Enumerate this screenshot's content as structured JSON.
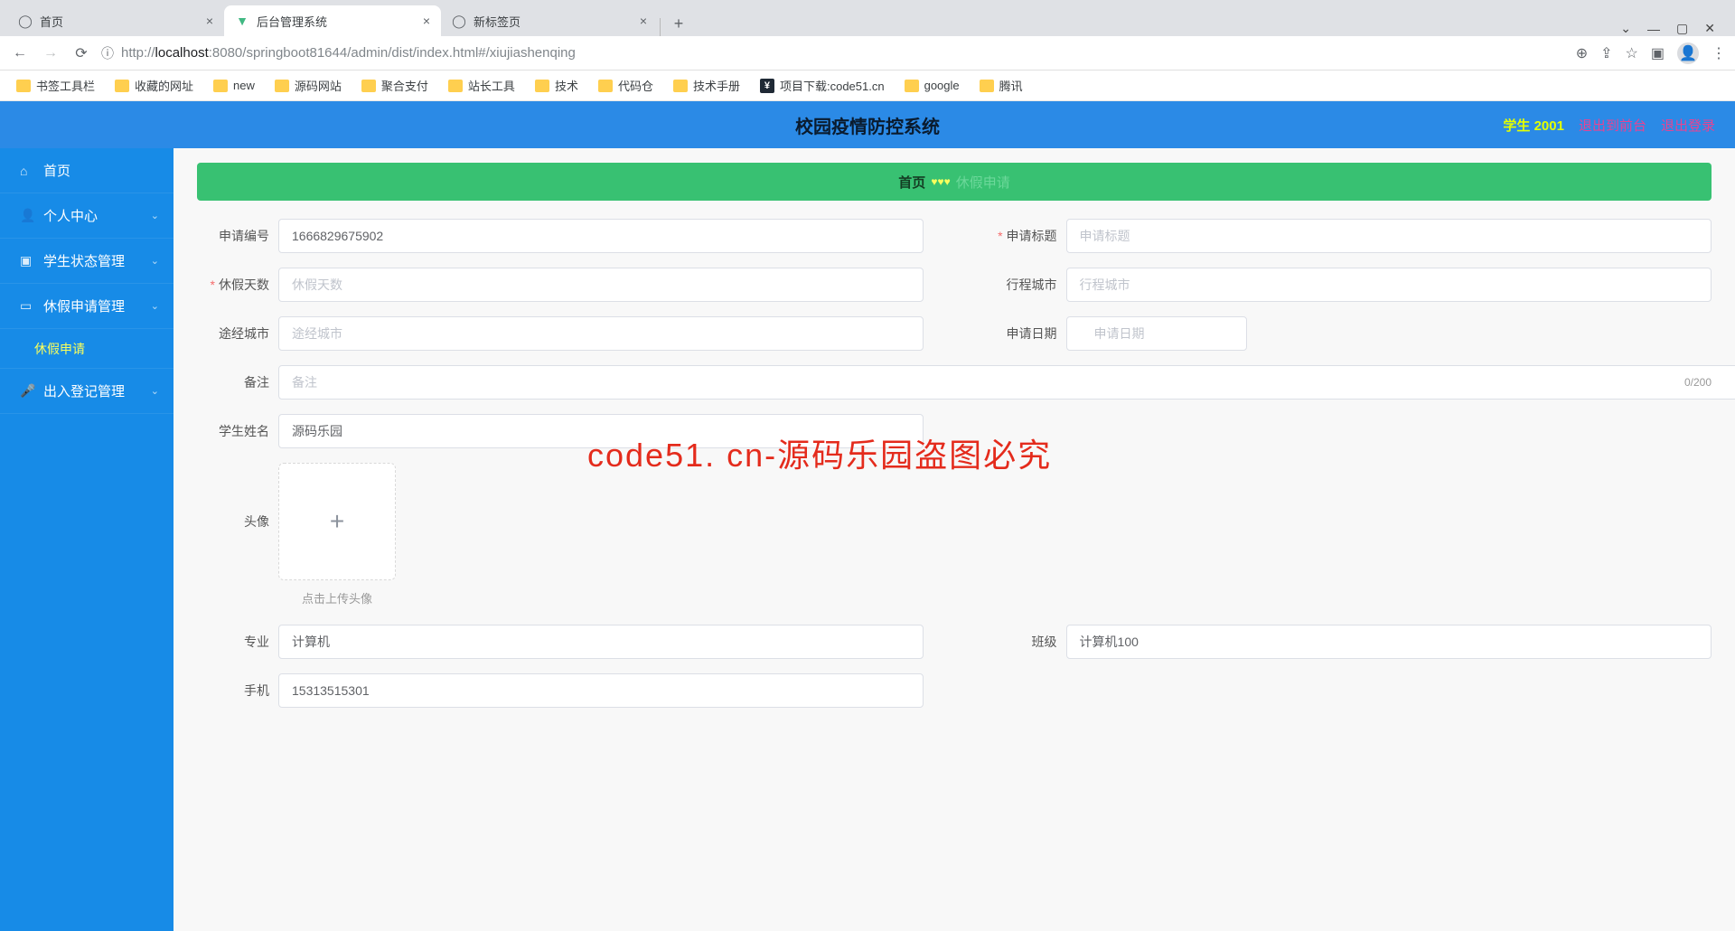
{
  "browser": {
    "tabs": [
      {
        "title": "首页",
        "icon": "globe"
      },
      {
        "title": "后台管理系统",
        "icon": "vue"
      },
      {
        "title": "新标签页",
        "icon": "globe"
      }
    ],
    "url_host": "localhost",
    "url_port": ":8080",
    "url_path": "/springboot81644/admin/dist/index.html#/xiujiashenqing",
    "url_prefix": "http://"
  },
  "bookmarks": [
    "书签工具栏",
    "收藏的网址",
    "new",
    "源码网站",
    "聚合支付",
    "站长工具",
    "技术",
    "代码仓",
    "技术手册",
    "项目下载:code51.cn",
    "google",
    "腾讯"
  ],
  "header": {
    "title": "校园疫情防控系统",
    "user_role": "学生",
    "user_id": "2001",
    "logout_front": "退出到前台",
    "logout": "退出登录"
  },
  "sidebar": {
    "home": "首页",
    "personal": "个人中心",
    "student_status": "学生状态管理",
    "leave_mgmt": "休假申请管理",
    "leave_apply": "休假申请",
    "inout": "出入登记管理"
  },
  "breadcrumb": {
    "home": "首页",
    "current": "休假申请"
  },
  "form": {
    "labels": {
      "apply_no": "申请编号",
      "apply_title": "申请标题",
      "leave_days": "休假天数",
      "travel_city": "行程城市",
      "via_city": "途经城市",
      "apply_date": "申请日期",
      "remark": "备注",
      "student_name": "学生姓名",
      "avatar": "头像",
      "major": "专业",
      "class": "班级",
      "phone": "手机"
    },
    "placeholders": {
      "apply_title": "申请标题",
      "leave_days": "休假天数",
      "travel_city": "行程城市",
      "via_city": "途经城市",
      "apply_date": "申请日期",
      "remark": "备注"
    },
    "values": {
      "apply_no": "1666829675902",
      "student_name": "源码乐园",
      "major": "计算机",
      "class": "计算机100",
      "phone": "15313515301"
    },
    "upload_hint": "点击上传头像",
    "char_counter": "0/200"
  },
  "watermark": "code51. cn-源码乐园盗图必究"
}
